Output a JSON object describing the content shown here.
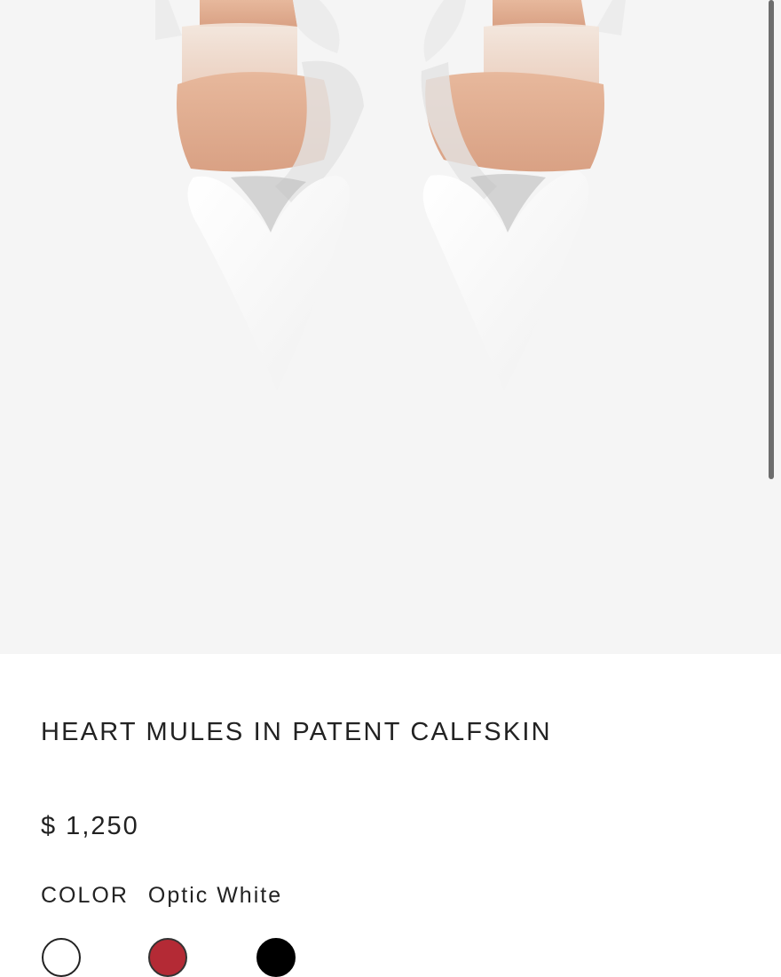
{
  "product": {
    "title": "HEART MULES IN PATENT CALFSKIN",
    "price": "$ 1,250",
    "color_label": "COLOR",
    "color_value": "Optic White"
  },
  "swatches": [
    {
      "name": "Optic White",
      "color": "#ffffff",
      "selected": true
    },
    {
      "name": "Red",
      "color": "#b42a35",
      "selected": false
    },
    {
      "name": "Black",
      "color": "#000000",
      "selected": false
    }
  ],
  "colors": {
    "hero_background": "#f5f5f5",
    "text": "#222222"
  }
}
